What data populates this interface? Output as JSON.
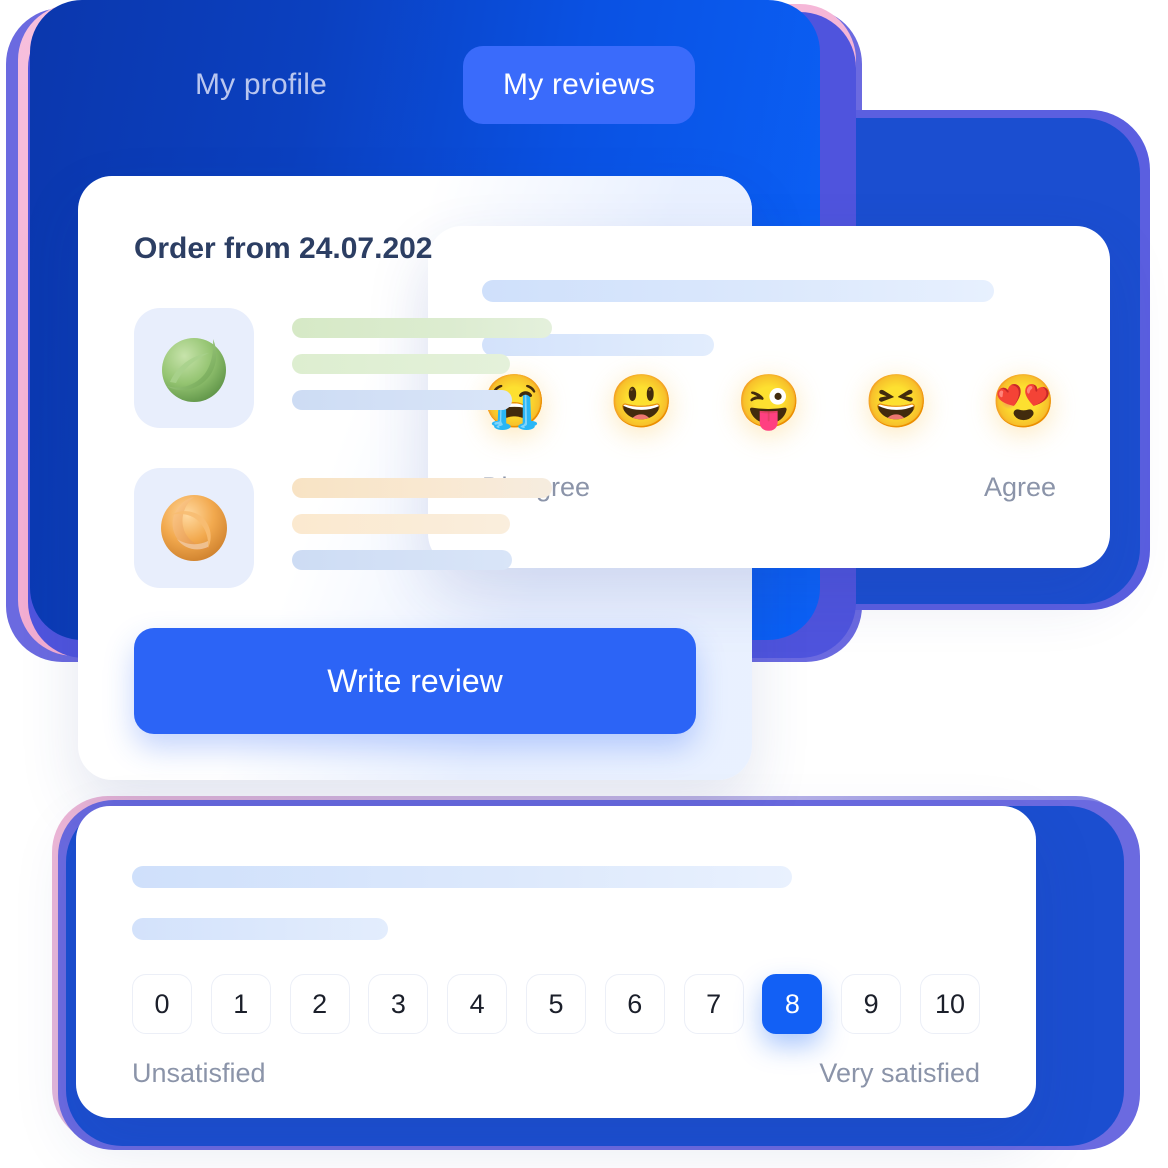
{
  "tabs": [
    {
      "label": "My profile",
      "active": false
    },
    {
      "label": "My reviews",
      "active": true
    }
  ],
  "order_card": {
    "title": "Order from 24.07.202",
    "products": [
      {
        "icon": "green-sphere-product-icon",
        "bar_colors": [
          "green",
          "green",
          "blue"
        ]
      },
      {
        "icon": "orange-swirl-product-icon",
        "bar_colors": [
          "orange",
          "orange",
          "blue"
        ]
      }
    ],
    "write_review_label": "Write review"
  },
  "emoji_card": {
    "scale": [
      {
        "glyph": "😭",
        "name": "loudly-crying-face-emoji"
      },
      {
        "glyph": "😃",
        "name": "grinning-face-emoji"
      },
      {
        "glyph": "😜",
        "name": "winking-face-with-tongue-emoji"
      },
      {
        "glyph": "😆",
        "name": "grinning-squinting-face-emoji"
      },
      {
        "glyph": "😍",
        "name": "smiling-face-with-heart-eyes-emoji"
      }
    ],
    "left_label": "Disagree",
    "right_label": "Agree"
  },
  "nps_card": {
    "values": [
      "0",
      "1",
      "2",
      "3",
      "4",
      "5",
      "6",
      "7",
      "8",
      "9",
      "10"
    ],
    "selected_value": "8",
    "left_label": "Unsatisfied",
    "right_label": "Very satisfied"
  },
  "colors": {
    "brand_blue": "#1260f5",
    "panel_blue_dark": "#0b37ad",
    "panel_blue_light": "#0b62f8",
    "active_tab_blue": "#3a6bfb",
    "deco_pink": "#f3aed2",
    "deco_purple": "#6b6ae0",
    "muted_text": "#8b94a9",
    "title_text": "#2c3e63"
  }
}
